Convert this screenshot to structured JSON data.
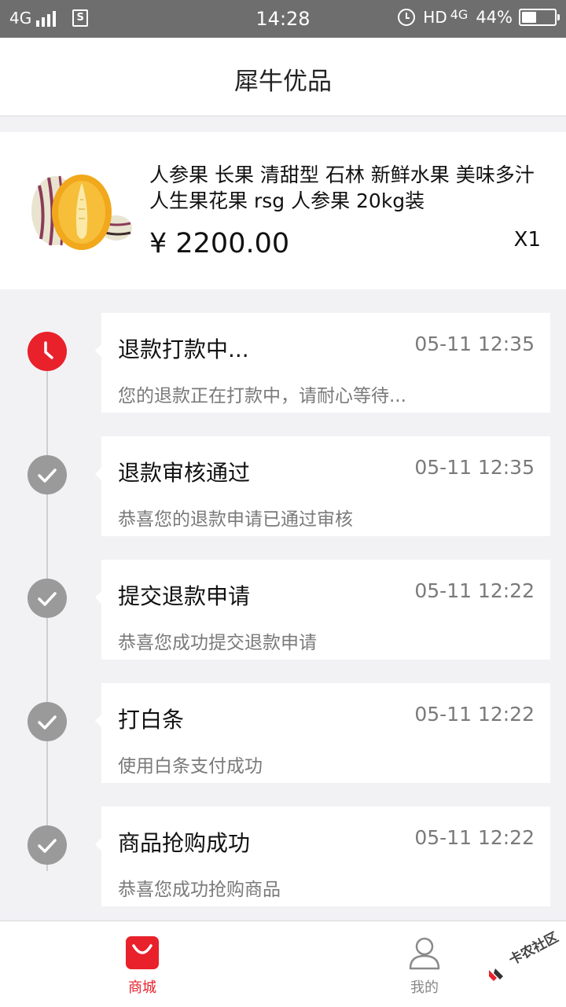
{
  "status_bar": {
    "network": "4G",
    "time": "14:28",
    "hd": "HD",
    "network_right": "4G",
    "battery_percent": "44%",
    "battery_level": 0.44,
    "icons": [
      "signal-icon",
      "sim-icon",
      "alarm-icon",
      "battery-icon"
    ]
  },
  "header": {
    "title": "犀牛优品"
  },
  "product": {
    "name": "人参果 长果 清甜型 石林 新鲜水果 美味多汁 人生果花果 rsg 人参果 20kg装",
    "price": "¥ 2200.00",
    "quantity": "X1",
    "image_icon": "fruit-image"
  },
  "timeline": [
    {
      "title": "退款打款中...",
      "time": "05-11 12:35",
      "desc": "您的退款正在打款中，请耐心等待...",
      "status": "active",
      "icon": "clock-icon"
    },
    {
      "title": "退款审核通过",
      "time": "05-11 12:35",
      "desc": "恭喜您的退款申请已通过审核",
      "status": "done",
      "icon": "check-icon"
    },
    {
      "title": "提交退款申请",
      "time": "05-11 12:22",
      "desc": "恭喜您成功提交退款申请",
      "status": "done",
      "icon": "check-icon"
    },
    {
      "title": "打白条",
      "time": "05-11 12:22",
      "desc": "使用白条支付成功",
      "status": "done",
      "icon": "check-icon"
    },
    {
      "title": "商品抢购成功",
      "time": "05-11 12:22",
      "desc": "恭喜您成功抢购商品",
      "status": "done",
      "icon": "check-icon"
    }
  ],
  "tab_bar": {
    "shop_label": "商城",
    "mine_label": "我的",
    "active_tab": "shop"
  },
  "watermark": {
    "text": "卡农社区"
  },
  "colors": {
    "accent": "#e8212b",
    "done_dot": "#9a9a9a",
    "status_bar": "#6e6e6e",
    "background": "#f2f2f5"
  }
}
